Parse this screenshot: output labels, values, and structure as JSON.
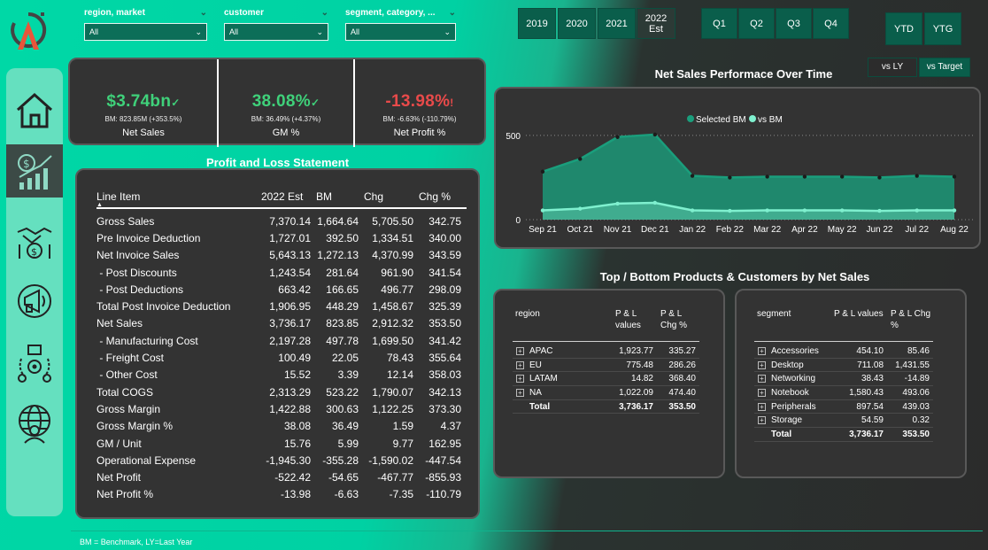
{
  "filters": {
    "region_market": {
      "label": "region, market",
      "value": "All"
    },
    "customer": {
      "label": "customer",
      "value": "All"
    },
    "segment": {
      "label": "segment, category, ...",
      "value": "All"
    }
  },
  "years": [
    {
      "label": "2019",
      "sub": ""
    },
    {
      "label": "2020",
      "sub": ""
    },
    {
      "label": "2021",
      "sub": ""
    },
    {
      "label": "2022",
      "sub": "Est"
    }
  ],
  "quarters": [
    "Q1",
    "Q2",
    "Q3",
    "Q4"
  ],
  "ytd": [
    "YTD",
    "YTG"
  ],
  "sidebar": {
    "items": [
      {
        "icon": "home-icon"
      },
      {
        "icon": "finance-chart-icon"
      },
      {
        "icon": "sales-handshake-icon"
      },
      {
        "icon": "marketing-megaphone-icon"
      },
      {
        "icon": "supply-chain-icon"
      },
      {
        "icon": "executive-globe-icon"
      }
    ]
  },
  "kpis": [
    {
      "value": "$3.74bn",
      "mark": "✓",
      "bm": "BM: 823.85M (+353.5%)",
      "label": "Net Sales",
      "color": "#3fd17a"
    },
    {
      "value": "38.08%",
      "mark": "✓",
      "bm": "BM: 36.49% (+4.37%)",
      "label": "GM %",
      "color": "#3fd17a"
    },
    {
      "value": "-13.98%",
      "mark": "!",
      "bm": "BM: -6.63% (-110.79%)",
      "label": "Net Profit %",
      "color": "#e84a4a"
    }
  ],
  "pl": {
    "title": "Profit and Loss Statement",
    "headers": [
      "Line Item",
      "2022 Est",
      "BM",
      "Chg",
      "Chg %"
    ],
    "rows": [
      [
        "Gross Sales",
        "7,370.14",
        "1,664.64",
        "5,705.50",
        "342.75"
      ],
      [
        "Pre Invoice Deduction",
        "1,727.01",
        "392.50",
        "1,334.51",
        "340.00"
      ],
      [
        "Net Invoice Sales",
        "5,643.13",
        "1,272.13",
        "4,370.99",
        "343.59"
      ],
      [
        " - Post Discounts",
        "1,243.54",
        "281.64",
        "961.90",
        "341.54"
      ],
      [
        " - Post Deductions",
        "663.42",
        "166.65",
        "496.77",
        "298.09"
      ],
      [
        "Total Post Invoice Deduction",
        "1,906.95",
        "448.29",
        "1,458.67",
        "325.39"
      ],
      [
        "Net Sales",
        "3,736.17",
        "823.85",
        "2,912.32",
        "353.50"
      ],
      [
        " - Manufacturing Cost",
        "2,197.28",
        "497.78",
        "1,699.50",
        "341.42"
      ],
      [
        " - Freight Cost",
        "100.49",
        "22.05",
        "78.43",
        "355.64"
      ],
      [
        " - Other Cost",
        "15.52",
        "3.39",
        "12.14",
        "358.03"
      ],
      [
        "Total COGS",
        "2,313.29",
        "523.22",
        "1,790.07",
        "342.13"
      ],
      [
        "Gross Margin",
        "1,422.88",
        "300.63",
        "1,122.25",
        "373.30"
      ],
      [
        "Gross Margin %",
        "38.08",
        "36.49",
        "1.59",
        "4.37"
      ],
      [
        "GM / Unit",
        "15.76",
        "5.99",
        "9.77",
        "162.95"
      ],
      [
        "Operational Expense",
        "-1,945.30",
        "-355.28",
        "-1,590.02",
        "-447.54"
      ],
      [
        "Net Profit",
        "-522.42",
        "-54.65",
        "-467.77",
        "-855.93"
      ],
      [
        "Net Profit %",
        "-13.98",
        "-6.63",
        "-7.35",
        "-110.79"
      ]
    ]
  },
  "chart_toggle": [
    "vs LY",
    "vs Target"
  ],
  "chart_data": {
    "type": "area",
    "title": "Net Sales Performace Over Time",
    "legend": [
      "Selected BM",
      "vs BM"
    ],
    "legend_position": "top-center",
    "categories": [
      "Sep 21",
      "Oct 21",
      "Nov 21",
      "Dec 21",
      "Jan 22",
      "Feb 22",
      "Mar 22",
      "Apr 22",
      "May 22",
      "Jun 22",
      "Jul 22",
      "Aug 22"
    ],
    "series": [
      {
        "name": "Selected BM",
        "values": [
          285,
          360,
          490,
          505,
          260,
          250,
          255,
          255,
          255,
          250,
          260,
          255
        ],
        "color": "#1a9e7c"
      },
      {
        "name": "vs BM",
        "values": [
          55,
          65,
          95,
          100,
          55,
          52,
          55,
          55,
          55,
          52,
          55,
          55
        ],
        "color": "#7ff0cf"
      }
    ],
    "yticks": [
      "0",
      "500"
    ],
    "ylim": [
      0,
      620
    ],
    "grid": false
  },
  "tb": {
    "title": "Top / Bottom Products & Customers by Net Sales",
    "region": {
      "headers": [
        "region",
        "P & L values",
        "P & L Chg %"
      ],
      "rows": [
        [
          "APAC",
          "1,923.77",
          "335.27"
        ],
        [
          "EU",
          "775.48",
          "286.26"
        ],
        [
          "LATAM",
          "14.82",
          "368.40"
        ],
        [
          "NA",
          "1,022.09",
          "474.40"
        ]
      ],
      "total": [
        "Total",
        "3,736.17",
        "353.50"
      ]
    },
    "segment": {
      "headers": [
        "segment",
        "P & L values",
        "P & L Chg %"
      ],
      "rows": [
        [
          "Accessories",
          "454.10",
          "85.46"
        ],
        [
          "Desktop",
          "711.08",
          "1,431.55"
        ],
        [
          "Networking",
          "38.43",
          "-14.89"
        ],
        [
          "Notebook",
          "1,580.43",
          "493.06"
        ],
        [
          "Peripherals",
          "897.54",
          "439.03"
        ],
        [
          "Storage",
          "54.59",
          "0.32"
        ]
      ],
      "total": [
        "Total",
        "3,736.17",
        "353.50"
      ]
    }
  },
  "footer": "BM = Benchmark, LY=Last Year"
}
